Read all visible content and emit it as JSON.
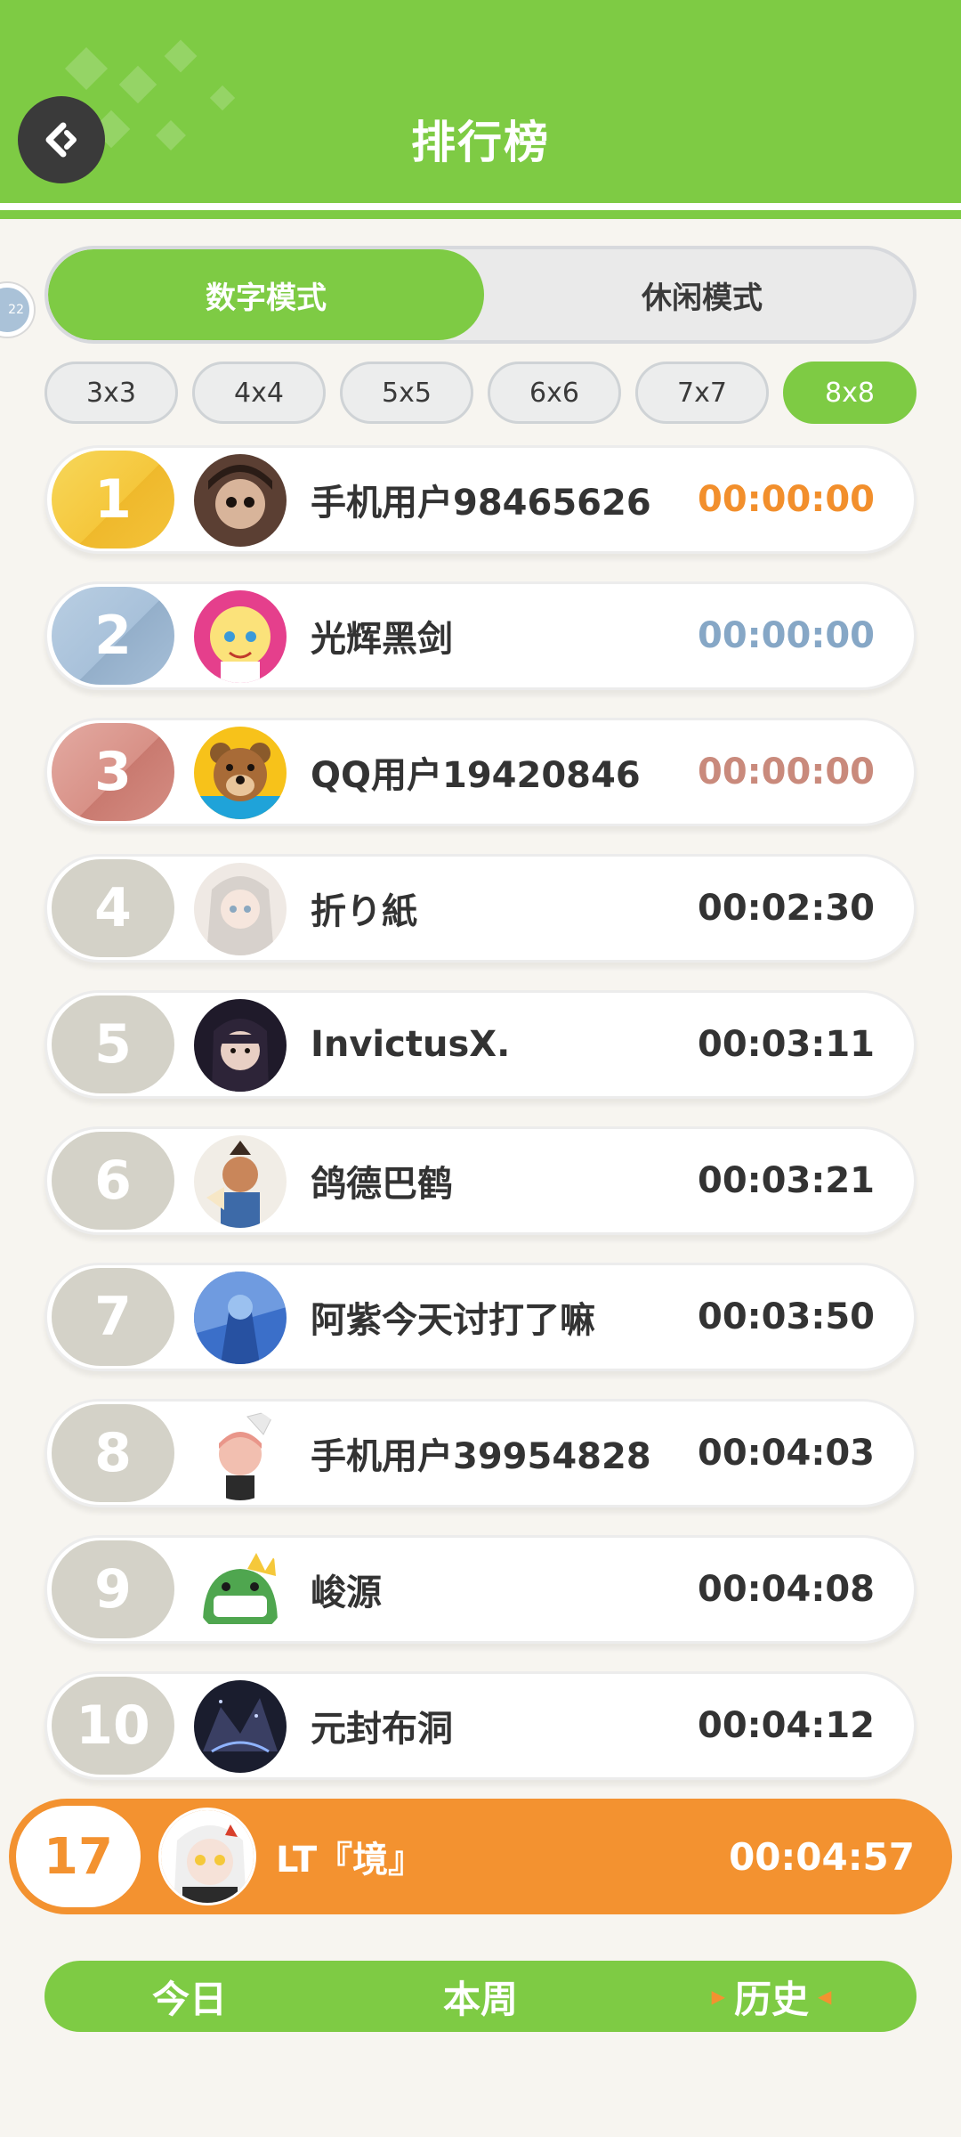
{
  "header": {
    "title": "排行榜",
    "color": "#7ecb44"
  },
  "side_indicator": {
    "text": "22"
  },
  "modes": [
    {
      "label": "数字模式",
      "active": true
    },
    {
      "label": "休闲模式",
      "active": false
    }
  ],
  "sizes": [
    {
      "label": "3x3",
      "active": false
    },
    {
      "label": "4x4",
      "active": false
    },
    {
      "label": "5x5",
      "active": false
    },
    {
      "label": "6x6",
      "active": false
    },
    {
      "label": "7x7",
      "active": false
    },
    {
      "label": "8x8",
      "active": true
    }
  ],
  "rankings": [
    {
      "rank": "1",
      "name": "手机用户98465626",
      "time": "00:00:00",
      "tier": "gold",
      "avatar_color": "#5b3f33"
    },
    {
      "rank": "2",
      "name": "光辉黑剑",
      "time": "00:00:00",
      "tier": "silver",
      "avatar_color": "#e53f8c"
    },
    {
      "rank": "3",
      "name": "QQ用户19420846",
      "time": "00:00:00",
      "tier": "bronze",
      "avatar_color": "#f7c21a"
    },
    {
      "rank": "4",
      "name": "折り紙",
      "time": "00:02:30",
      "tier": "normal",
      "avatar_color": "#d8d0c8"
    },
    {
      "rank": "5",
      "name": "InvictusX.",
      "time": "00:03:11",
      "tier": "normal",
      "avatar_color": "#1f1a2a"
    },
    {
      "rank": "6",
      "name": "鸽德巴鹤",
      "time": "00:03:21",
      "tier": "normal",
      "avatar_color": "#f1ede6"
    },
    {
      "rank": "7",
      "name": "阿紫今天讨打了嘛",
      "time": "00:03:50",
      "tier": "normal",
      "avatar_color": "#3b6fc9"
    },
    {
      "rank": "8",
      "name": "手机用户39954828",
      "time": "00:04:03",
      "tier": "normal",
      "avatar_color": "#f2d7d0"
    },
    {
      "rank": "9",
      "name": "峻源",
      "time": "00:04:08",
      "tier": "normal",
      "avatar_color": "#4fa64f"
    },
    {
      "rank": "10",
      "name": "元封布洞",
      "time": "00:04:12",
      "tier": "normal",
      "avatar_color": "#1a1d2e"
    }
  ],
  "me": {
    "rank": "17",
    "name": "LT『境』",
    "time": "00:04:57",
    "color": "#f39230"
  },
  "periods": [
    {
      "label": "今日",
      "active": false
    },
    {
      "label": "本周",
      "active": false
    },
    {
      "label": "历史",
      "active": true
    }
  ]
}
